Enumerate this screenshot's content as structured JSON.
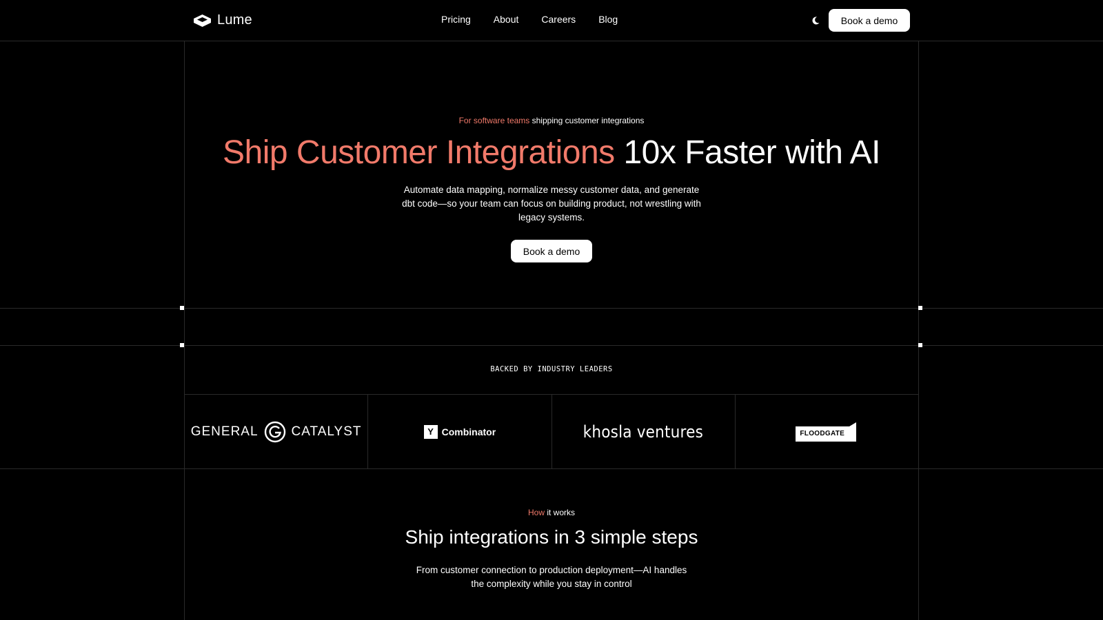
{
  "brand": {
    "name": "Lume",
    "logo_icon": "lume-cube-icon"
  },
  "nav": {
    "items": [
      "Pricing",
      "About",
      "Careers",
      "Blog"
    ]
  },
  "header": {
    "theme_icon": "moon-icon",
    "cta_label": "Book a demo"
  },
  "hero": {
    "eyebrow_accent": "For software teams",
    "eyebrow_rest": " shipping customer integrations",
    "title_accent": "Ship Customer Integrations",
    "title_rest": " 10x Faster with AI",
    "subtitle": "Automate data mapping, normalize messy customer data, and generate dbt code—so your team can focus on building product, not wrestling with legacy systems.",
    "cta_label": "Book a demo"
  },
  "backers": {
    "label": "BACKED BY INDUSTRY LEADERS",
    "general_catalyst": {
      "left": "GENERAL",
      "right": "CATALYST"
    },
    "y_combinator": {
      "mark": "Y",
      "name": "Combinator"
    },
    "khosla": "khosla ventures",
    "floodgate": "FLOODGATE"
  },
  "how": {
    "eyebrow_accent": "How",
    "eyebrow_rest": " it works",
    "title": "Ship integrations in 3 simple steps",
    "subtitle": "From customer connection to production deployment—AI handles the complexity while you stay in control"
  },
  "colors": {
    "accent": "#f17a6a",
    "background": "#000000",
    "grid": "#2a2a2a"
  }
}
